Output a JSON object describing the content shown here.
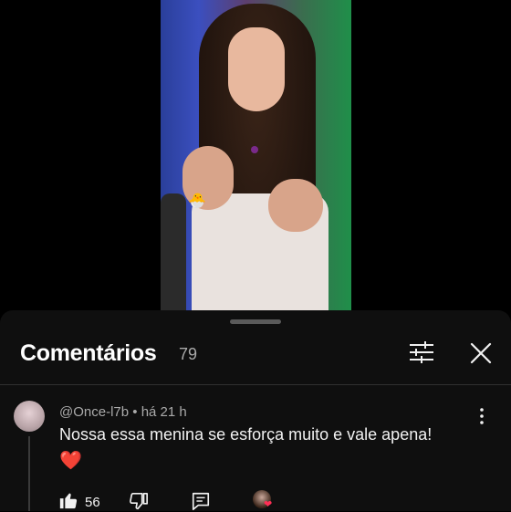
{
  "comments_panel": {
    "title": "Comentários",
    "count": "79",
    "filter_icon": "sliders-icon",
    "close_icon": "close-icon"
  },
  "comment": {
    "author": "@Once-l7b",
    "separator": "•",
    "time": "há 21 h",
    "text": "Nossa essa menina se esforça muito e vale apena!",
    "emoji": "❤️",
    "likes": "56",
    "more_icon": "more-vertical-icon",
    "like_icon": "thumb-up-icon",
    "dislike_icon": "thumb-down-icon",
    "reply_icon": "reply-icon",
    "creator_heart_icon": "creator-heart-icon"
  },
  "colors": {
    "background": "#0f0f0f",
    "text": "#f1f1f1",
    "secondary_text": "#aaaaaa",
    "heart": "#ff2e55"
  }
}
